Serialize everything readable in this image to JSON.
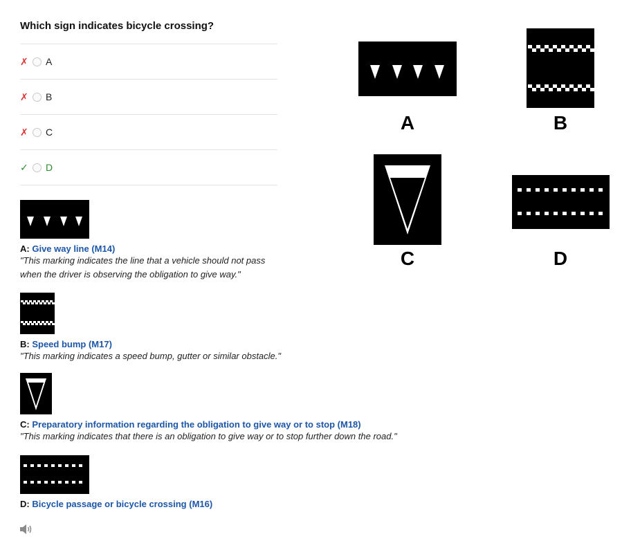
{
  "question": "Which sign indicates bicycle crossing?",
  "options": [
    {
      "label": "A",
      "status": "wrong",
      "mark": "✗"
    },
    {
      "label": "B",
      "status": "wrong",
      "mark": "✗"
    },
    {
      "label": "C",
      "status": "wrong",
      "mark": "✗"
    },
    {
      "label": "D",
      "status": "correct",
      "mark": "✓"
    }
  ],
  "explanations": [
    {
      "letter": "A:",
      "title": "Give way line (M14)",
      "quote_line1": "\"This marking indicates the line that a vehicle should not pass",
      "quote_line2": "when the driver is observing the obligation to give way.\""
    },
    {
      "letter": "B:",
      "title": "Speed bump (M17)",
      "quote": "\"This marking indicates a speed bump, gutter or similar obstacle.\""
    },
    {
      "letter": "C:",
      "title": "Preparatory information regarding the obligation to give way or to stop (M18)",
      "quote": "\"This marking indicates that there is an obligation to give way or to stop further down the road.\""
    },
    {
      "letter": "D:",
      "title": "Bicycle passage or bicycle crossing (M16)"
    }
  ],
  "large_signs": [
    {
      "letter": "A",
      "icon": "give-way-triangles-sign"
    },
    {
      "letter": "B",
      "icon": "speed-bump-checker-sign"
    },
    {
      "letter": "C",
      "icon": "inverted-triangle-sign"
    },
    {
      "letter": "D",
      "icon": "bicycle-crossing-squares-sign"
    }
  ],
  "audio_icon": "speaker-icon",
  "colors": {
    "wrong": "#dd3333",
    "correct": "#2e8b2e",
    "link": "#1c56a8"
  }
}
